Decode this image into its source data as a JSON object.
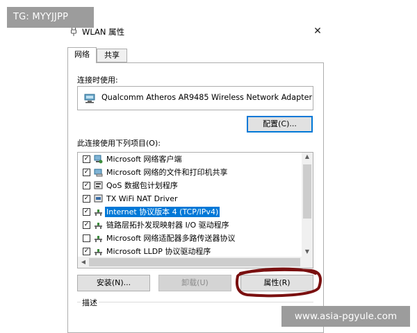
{
  "watermarks": {
    "top": "TG: MYYJJPP",
    "bottom": "www.asia-pgyule.com"
  },
  "window": {
    "title": "WLAN 属性",
    "close_glyph": "✕"
  },
  "tabs": [
    {
      "label": "网络",
      "active": true
    },
    {
      "label": "共享",
      "active": false
    }
  ],
  "connect_using": {
    "label": "连接时使用:",
    "adapter": "Qualcomm Atheros AR9485 Wireless Network Adapter",
    "configure_button": "配置(C)..."
  },
  "items_section": {
    "label": "此连接使用下列项目(O):",
    "items": [
      {
        "text": "Microsoft 网络客户端",
        "checked": true,
        "icon": "network-client-icon",
        "selected": false
      },
      {
        "text": "Microsoft 网络的文件和打印机共享",
        "checked": true,
        "icon": "file-printer-sharing-icon",
        "selected": false
      },
      {
        "text": "QoS 数据包计划程序",
        "checked": true,
        "icon": "qos-icon",
        "selected": false
      },
      {
        "text": "TX WiFi NAT Driver",
        "checked": true,
        "icon": "nat-driver-icon",
        "selected": false
      },
      {
        "text": "Internet 协议版本 4 (TCP/IPv4)",
        "checked": true,
        "icon": "protocol-icon",
        "selected": true
      },
      {
        "text": "链路层拓扑发现映射器 I/O 驱动程序",
        "checked": true,
        "icon": "protocol-icon",
        "selected": false
      },
      {
        "text": "Microsoft 网络适配器多路传送器协议",
        "checked": false,
        "icon": "protocol-icon",
        "selected": false
      },
      {
        "text": "Microsoft LLDP 协议驱动程序",
        "checked": true,
        "icon": "protocol-icon",
        "selected": false
      }
    ]
  },
  "buttons": {
    "install": "安装(N)...",
    "uninstall": "卸载(U)",
    "properties": "属性(R)"
  },
  "description_label": "描述",
  "colors": {
    "selection": "#0078d7",
    "annotation": "#7a1010"
  }
}
